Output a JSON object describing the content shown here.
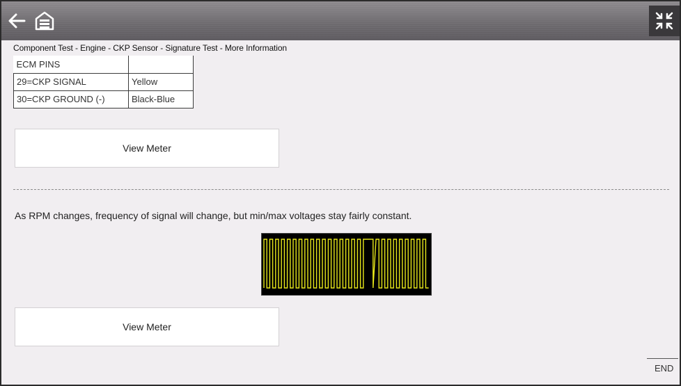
{
  "header": {
    "back_icon": "back-arrow-icon",
    "home_icon": "home-garage-icon",
    "exit_icon": "exit-fullscreen-icon"
  },
  "breadcrumb": "Component Test - Engine - CKP Sensor - Signature Test - More Information",
  "pins_table": {
    "header": [
      "ECM PINS",
      ""
    ],
    "rows": [
      [
        "29=CKP SIGNAL",
        "Yellow"
      ],
      [
        "30=CKP GROUND (-)",
        "Black-Blue"
      ]
    ]
  },
  "buttons": {
    "view_meter_1": "View Meter",
    "view_meter_2": "View Meter"
  },
  "info_text": "As RPM changes, frequency of signal will change, but min/max voltages stay fairly constant.",
  "waveform": {
    "trace_color": "#e8e81a",
    "background": "#000000"
  },
  "footer": {
    "end_label": "END"
  }
}
